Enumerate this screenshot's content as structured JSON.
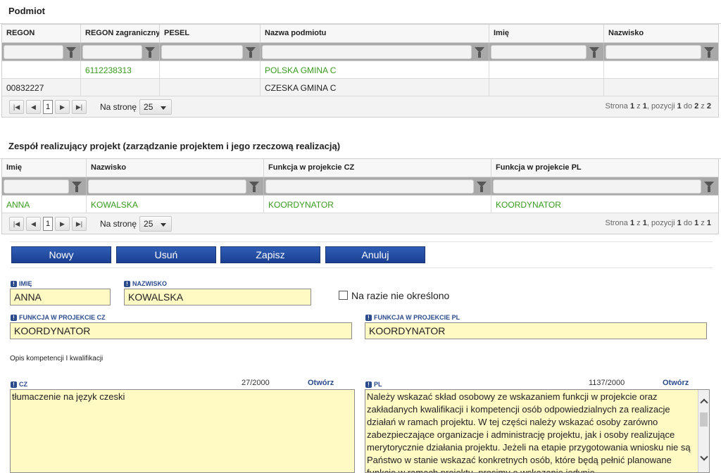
{
  "podmiot": {
    "title": "Podmiot",
    "columns": [
      "REGON",
      "REGON zagraniczny",
      "PESEL",
      "Nazwa podmiotu",
      "Imię",
      "Nazwisko"
    ],
    "rows": [
      [
        "",
        "6112238313",
        "",
        "POLSKA GMINA C",
        "",
        ""
      ],
      [
        "00832227",
        "",
        "",
        "CZESKA GMINA C",
        "",
        ""
      ]
    ],
    "pager": {
      "page": "1",
      "per_page_label": "Na stronę",
      "per_page": "25",
      "info_prefix": "Strona ",
      "info_page": "1",
      "info_of": " z ",
      "info_pages": "1",
      "info_items": ", pozycji ",
      "info_from": "1",
      "info_to_label": " do ",
      "info_to": "2",
      "info_total_label": " z ",
      "info_total": "2"
    }
  },
  "team": {
    "title": "Zespół realizujący projekt (zarządzanie projektem i jego rzeczową realizacją)",
    "columns": [
      "Imię",
      "Nazwisko",
      "Funkcja w projekcie CZ",
      "Funkcja w projekcie PL"
    ],
    "rows": [
      [
        "ANNA",
        "KOWALSKA",
        "KOORDYNATOR",
        "KOORDYNATOR"
      ]
    ],
    "pager": {
      "page": "1",
      "per_page_label": "Na stronę",
      "per_page": "25",
      "info_prefix": "Strona ",
      "info_page": "1",
      "info_of": " z ",
      "info_pages": "1",
      "info_items": ", pozycji ",
      "info_from": "1",
      "info_to_label": " do ",
      "info_to": "1",
      "info_total_label": " z ",
      "info_total": "1"
    }
  },
  "toolbar": {
    "new_label": "Nowy",
    "delete_label": "Usuń",
    "save_label": "Zapisz",
    "cancel_label": "Anuluj"
  },
  "form": {
    "first_name_label": "IMIĘ",
    "first_name_value": "ANNA",
    "last_name_label": "NAZWISKO",
    "last_name_value": "KOWALSKA",
    "not_specified_label": "Na razie nie określono",
    "function_cz_label": "FUNKCJA W PROJEKCIE CZ",
    "function_cz_value": "KOORDYNATOR",
    "function_pl_label": "FUNKCJA W PROJEKCIE PL",
    "function_pl_value": "KOORDYNATOR",
    "description_heading": "Opis kompetencji I kwalifikacji",
    "cz_label": "CZ",
    "cz_counter": "27/2000",
    "cz_open": "Otwórz",
    "cz_text": "tłumaczenie na język czeski",
    "pl_label": "PL",
    "pl_counter": "1137/2000",
    "pl_open": "Otwórz",
    "pl_text": "Należy wskazać skład osobowy ze wskazaniem funkcji w projekcie oraz zakładanych kwalifikacji i kompetencji osób odpowiedzialnych za realizacje działań w ramach projektu. W tej części należy wskazać osoby zarówno zabezpieczające organizacje i administrację projektu, jak i osoby realizujące merytorycznie działania projektu. Jeżeli na etapie przygotowania wniosku nie są Państwo w stanie wskazać konkretnych osób, które będą pełnić planowane funkcje w ramach projektu, prosimy o wskazanie jedynie"
  }
}
